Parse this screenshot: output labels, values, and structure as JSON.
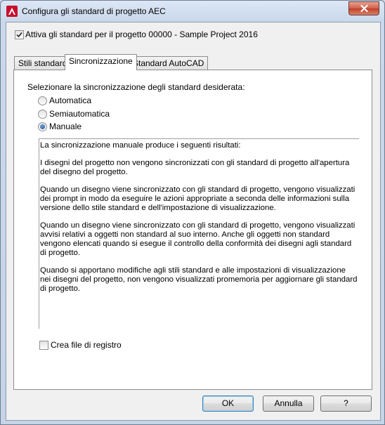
{
  "window": {
    "title": "Configura gli standard di progetto AEC"
  },
  "enable_standards": {
    "label": "Attiva gli standard per il progetto 00000 - Sample Project 2016",
    "checked": true
  },
  "tabs": [
    {
      "label": "Stili standard",
      "active": false
    },
    {
      "label": "Sincronizzazione",
      "active": true
    },
    {
      "label": "Standard AutoCAD",
      "active": false
    }
  ],
  "sync": {
    "prompt": "Selezionare la sincronizzazione degli standard desiderata:",
    "options": [
      {
        "label": "Automatica",
        "selected": false
      },
      {
        "label": "Semiautomatica",
        "selected": false
      },
      {
        "label": "Manuale",
        "selected": true
      }
    ],
    "description": [
      "La sincronizzazione manuale produce i seguenti risultati:",
      "I disegni del progetto non vengono sincronizzati con gli standard di progetto all'apertura del disegno del progetto.",
      "Quando un disegno viene sincronizzato con gli standard di progetto, vengono visualizzati dei prompt in modo da eseguire le azioni appropriate a seconda delle informazioni sulla versione dello stile standard e dell'impostazione di visualizzazione.",
      "Quando un disegno viene sincronizzato con gli standard di progetto, vengono visualizzati avvisi relativi a oggetti non standard al suo interno. Anche gli oggetti non standard vengono elencati quando si esegue il controllo della conformità dei disegni agli standard di progetto.",
      "Quando si apportano modifiche agli stili standard e alle impostazioni di visualizzazione nei disegni del progetto, non vengono visualizzati promemoria per aggiornare gli standard di progetto."
    ],
    "log_file": {
      "label": "Crea file di registro",
      "checked": false
    }
  },
  "buttons": {
    "ok": "OK",
    "cancel": "Annulla",
    "help": "?"
  },
  "colors": {
    "app_icon": "#c8102e",
    "close_button": "#c1412a",
    "default_button_border": "#3c7fb1"
  }
}
